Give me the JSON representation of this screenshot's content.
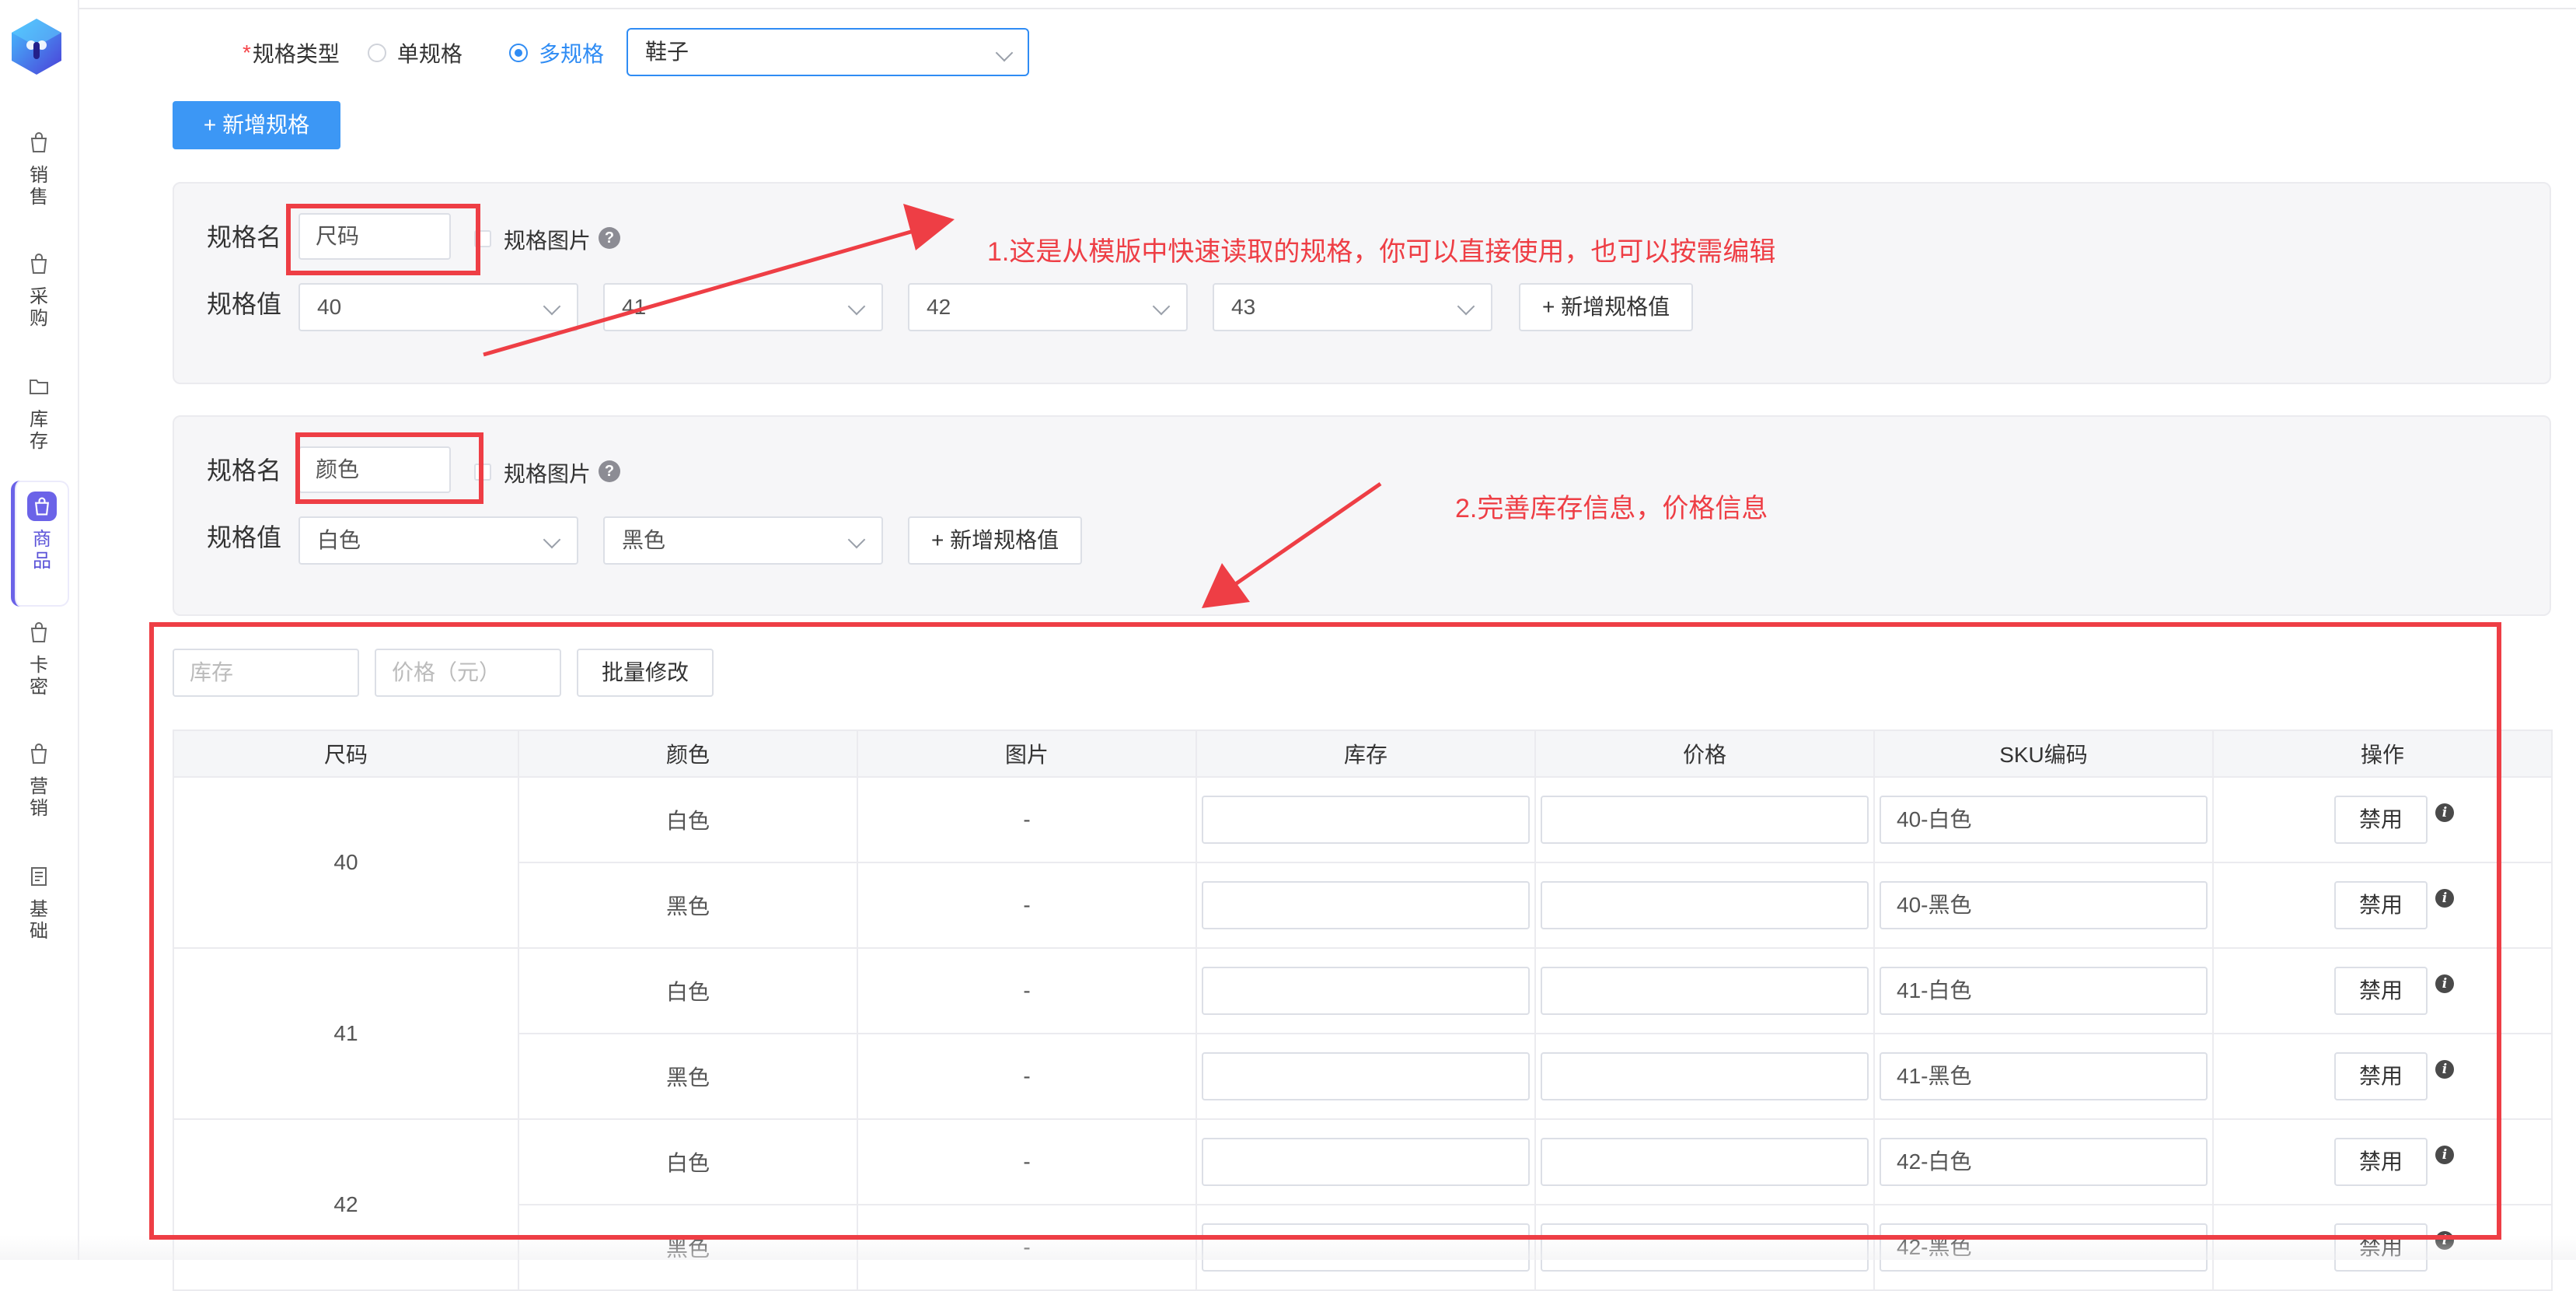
{
  "sidebar": {
    "items": [
      {
        "label": "销售",
        "icon": "shopping-bag-icon"
      },
      {
        "label": "采购",
        "icon": "shopping-bag-icon"
      },
      {
        "label": "库存",
        "icon": "folder-icon"
      },
      {
        "label": "商品",
        "icon": "shopping-bag-icon"
      },
      {
        "label": "卡密",
        "icon": "shopping-bag-icon"
      },
      {
        "label": "营销",
        "icon": "shopping-bag-icon"
      },
      {
        "label": "基础",
        "icon": "document-icon"
      }
    ],
    "active_index": 3,
    "active_color": "#6b63e8"
  },
  "spec_type": {
    "required_mark": "*",
    "label": "规格类型",
    "options": [
      "单规格",
      "多规格"
    ],
    "selected": "多规格",
    "template_value": "鞋子"
  },
  "add_spec_button": "新增规格",
  "add_spec_icon": "+",
  "specs": [
    {
      "name_label": "规格名",
      "name_value": "尺码",
      "image_label": "规格图片",
      "value_label": "规格值",
      "values": [
        "40",
        "41",
        "42",
        "43"
      ],
      "add_value_button": "+ 新增规格值"
    },
    {
      "name_label": "规格名",
      "name_value": "颜色",
      "image_label": "规格图片",
      "value_label": "规格值",
      "values": [
        "白色",
        "黑色"
      ],
      "add_value_button": "+ 新增规格值"
    }
  ],
  "annotations": {
    "note1": "1.这是从模版中快速读取的规格，你可以直接使用，也可以按需编辑",
    "note2": "2.完善库存信息，价格信息",
    "color": "#ee3e45"
  },
  "batch": {
    "stock_placeholder": "库存",
    "price_placeholder": "价格（元）",
    "button": "批量修改"
  },
  "sku_table": {
    "headers": [
      "尺码",
      "颜色",
      "图片",
      "库存",
      "价格",
      "SKU编码",
      "操作"
    ],
    "rows": [
      {
        "size": "40",
        "color": "白色",
        "image": "-",
        "sku": "40-白色",
        "action": "禁用"
      },
      {
        "size": "40",
        "color": "黑色",
        "image": "-",
        "sku": "40-黑色",
        "action": "禁用"
      },
      {
        "size": "41",
        "color": "白色",
        "image": "-",
        "sku": "41-白色",
        "action": "禁用"
      },
      {
        "size": "41",
        "color": "黑色",
        "image": "-",
        "sku": "41-黑色",
        "action": "禁用"
      },
      {
        "size": "42",
        "color": "白色",
        "image": "-",
        "sku": "42-白色",
        "action": "禁用"
      },
      {
        "size": "42",
        "color": "黑色",
        "image": "-",
        "sku": "42-黑色",
        "action": "禁用"
      }
    ]
  },
  "colors": {
    "primary": "#3c97f5",
    "radio_active": "#2f8cf4"
  }
}
